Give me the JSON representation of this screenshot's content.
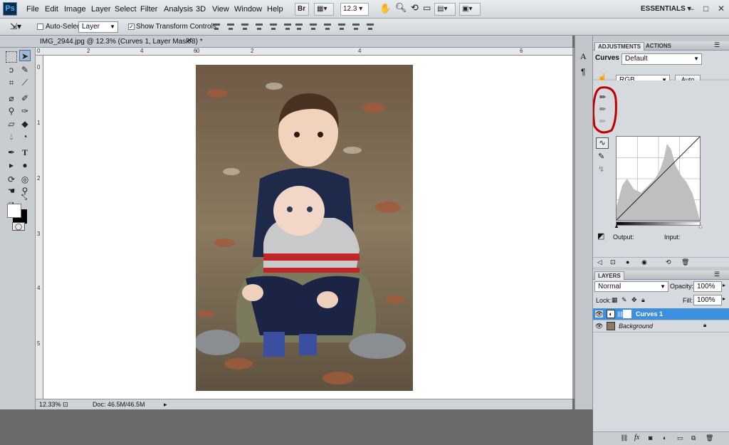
{
  "app": {
    "logo": "Ps",
    "workspace": "ESSENTIALS"
  },
  "menu": [
    "File",
    "Edit",
    "Image",
    "Layer",
    "Select",
    "Filter",
    "Analysis",
    "3D",
    "View",
    "Window",
    "Help"
  ],
  "menubar": {
    "bridge_label": "Br",
    "zoom": "12.3"
  },
  "options": {
    "auto_select_label": "Auto-Select:",
    "auto_select_value": "Layer",
    "show_transform_label": "Show Transform Controls"
  },
  "document": {
    "tab_title": "IMG_2944.jpg @ 12.3% (Curves 1, Layer Mask/8) *",
    "zoom_status": "12.33%",
    "doc_info": "Doc: 46.5M/46.5M",
    "ruler_h": [
      "0",
      "2",
      "4",
      "6",
      "0",
      "2",
      "4",
      "6"
    ],
    "ruler_v": [
      "0",
      "1",
      "2",
      "3",
      "4",
      "5"
    ]
  },
  "adjustments": {
    "tabs": [
      "ADJUSTMENTS",
      "ACTIONS"
    ],
    "title": "Curves",
    "preset": "Default",
    "channel": "RGB",
    "auto_label": "Auto",
    "output_label": "Output:",
    "input_label": "Input:"
  },
  "layers": {
    "tab": "LAYERS",
    "blend_mode": "Normal",
    "opacity_label": "Opacity:",
    "opacity_value": "100%",
    "lock_label": "Lock:",
    "fill_label": "Fill:",
    "fill_value": "100%",
    "items": [
      {
        "name": "Curves 1",
        "selected": true
      },
      {
        "name": "Background",
        "selected": false
      }
    ]
  },
  "colors": {
    "selected_layer": "#3d8fe0",
    "annotation": "#c00000",
    "panel": "#d6d9dd"
  }
}
